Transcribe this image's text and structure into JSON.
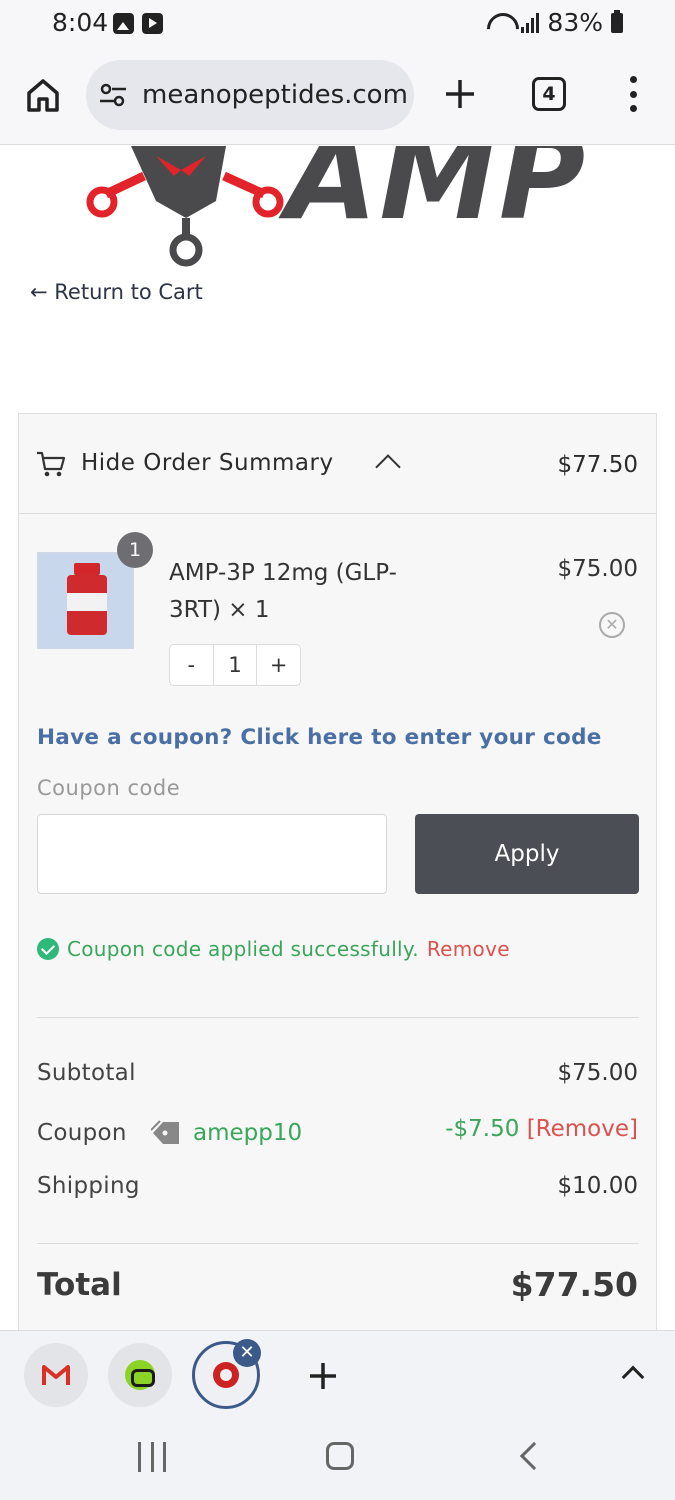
{
  "status_bar": {
    "time": "8:04",
    "battery": "83%"
  },
  "browser": {
    "url": "meanopeptides.com",
    "tab_count": "4",
    "icons": [
      "home-icon",
      "site-settings-icon",
      "new-tab-icon",
      "tab-switcher-icon",
      "more-menu-icon"
    ]
  },
  "page": {
    "logo_text": "AMP",
    "return_link": "← Return to Cart"
  },
  "order_summary": {
    "toggle_label": "Hide Order Summary",
    "header_total": "$77.50",
    "item": {
      "badge_qty": "1",
      "name": "AMP-3P 12mg (GLP-3RT) × 1",
      "price": "$75.00",
      "stepper": {
        "minus": "-",
        "value": "1",
        "plus": "+"
      }
    },
    "coupon": {
      "link_text": "Have a coupon? Click here to enter your code",
      "label": "Coupon code",
      "input_value": "",
      "apply_label": "Apply",
      "success_text": "Coupon code applied successfully.",
      "success_remove": "Remove"
    },
    "totals": {
      "subtotal_label": "Subtotal",
      "subtotal_value": "$75.00",
      "coupon_label": "Coupon",
      "coupon_code": "amepp10",
      "coupon_discount": "-$7.50",
      "coupon_remove": "[Remove]",
      "shipping_label": "Shipping",
      "shipping_value": "$10.00",
      "total_label": "Total",
      "total_value": "$77.50"
    }
  },
  "colors": {
    "accent_link": "#4a6fa5",
    "success_green": "#3aa55b",
    "remove_red": "#d9534f",
    "button_dark": "#4b4e54"
  }
}
